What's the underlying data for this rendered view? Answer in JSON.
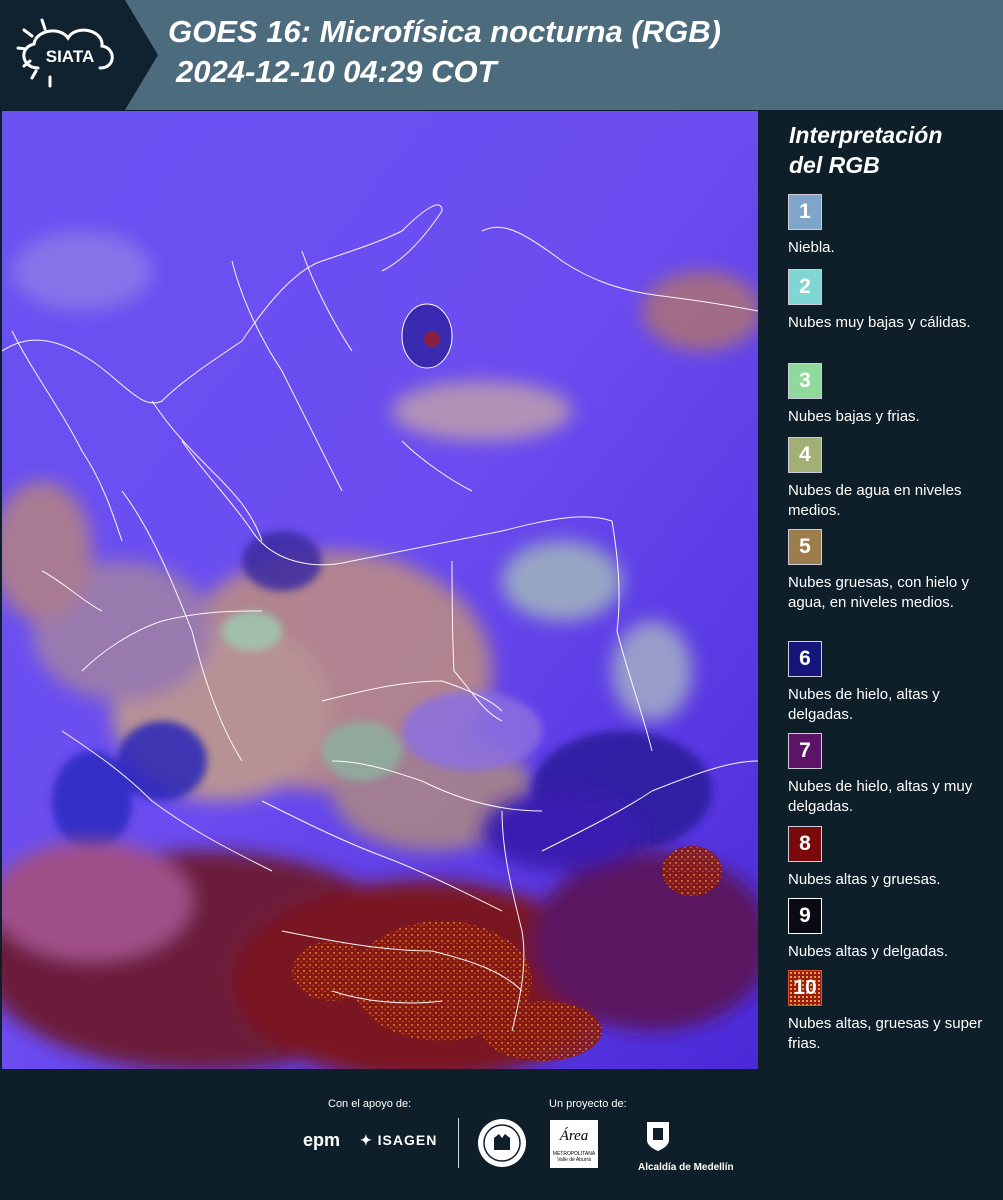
{
  "header": {
    "logo_text": "SIATA",
    "title_line1": "GOES 16: Microfísica nocturna (RGB)",
    "title_line2": "2024-12-10 04:29 COT"
  },
  "legend": {
    "title_line1": "Interpretación",
    "title_line2": "del RGB",
    "items": [
      {
        "number": "1",
        "color": "#7fa6c9",
        "desc": "Niebla."
      },
      {
        "number": "2",
        "color": "#7fd6d3",
        "desc": "Nubes muy bajas y cálidas."
      },
      {
        "number": "3",
        "color": "#8fd99a",
        "desc": "Nubes bajas y frias."
      },
      {
        "number": "4",
        "color": "#a3b075",
        "desc": "Nubes de agua en niveles medios."
      },
      {
        "number": "5",
        "color": "#9c7d4b",
        "desc": "Nubes gruesas, con hielo y agua, en niveles medios."
      },
      {
        "number": "6",
        "color": "#15157a",
        "desc": "Nubes de hielo, altas y delgadas."
      },
      {
        "number": "7",
        "color": "#5e1466",
        "desc": "Nubes de hielo, altas y muy delgadas."
      },
      {
        "number": "8",
        "color": "#7a0a0a",
        "desc": "Nubes altas y gruesas."
      },
      {
        "number": "9",
        "color": "#0a0a14",
        "desc": "Nubes altas y delgadas."
      },
      {
        "number": "10",
        "color": "#9b1a12",
        "desc": "Nubes altas, gruesas y super frias."
      }
    ]
  },
  "footer": {
    "support_label": "Con el apoyo de:",
    "project_label": "Un proyecto de:",
    "sponsor_epm": "epm",
    "sponsor_isagen": "ISAGEN",
    "partner_area": "Área",
    "partner_area_sub": "METROPOLITANA",
    "partner_area_sub2": "Valle de Aburrá",
    "partner_medellin": "Alcaldía de Medellín"
  },
  "colors": {
    "header_bg": "#4c6b7d",
    "page_bg": "#0f1f2a",
    "map_base": "#5a3cf0"
  }
}
